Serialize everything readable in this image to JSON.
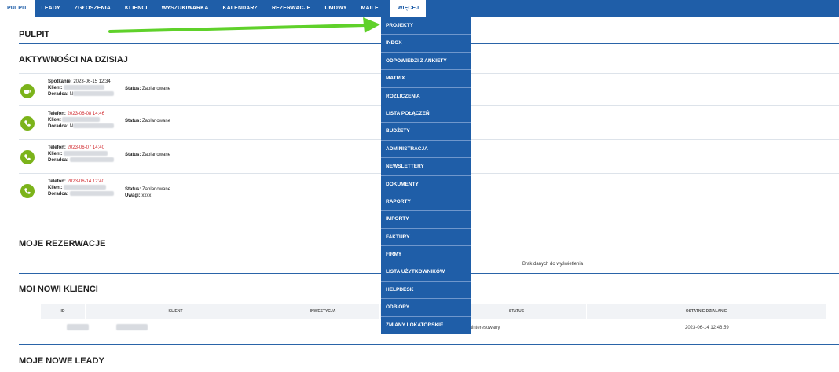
{
  "nav": {
    "items": [
      "PULPIT",
      "LEADY",
      "ZGŁOSZENIA",
      "KLIENCI",
      "WYSZUKIWARKA",
      "KALENDARZ",
      "REZERWACJE",
      "UMOWY",
      "MAILE"
    ],
    "more_label": "WIĘCEJ"
  },
  "page_title": "PULPIT",
  "activities": {
    "title": "AKTYWNOŚCI NA DZISIAJ",
    "items": [
      {
        "type_label": "Spotkanie:",
        "datetime": "2023-06-15 12:34",
        "client_label": "Klient:",
        "advisor_label": "Doradca:",
        "advisor_prefix": "N",
        "status_label": "Status:",
        "status_value": "Zaplanowane",
        "note_label": "",
        "note_value": "",
        "icon": "coffee-icon",
        "overdue": false
      },
      {
        "type_label": "Telefon:",
        "datetime": "2023-06-08 14:46",
        "client_label": "Klient",
        "advisor_label": "Doradca:",
        "advisor_prefix": "N",
        "status_label": "Status:",
        "status_value": "Zaplanowane",
        "note_label": "",
        "note_value": "",
        "icon": "phone-icon",
        "overdue": true
      },
      {
        "type_label": "Telefon:",
        "datetime": "2023-06-07 14:40",
        "client_label": "Klient:",
        "advisor_label": "Doradca:",
        "advisor_prefix": "",
        "status_label": "Status:",
        "status_value": "Zaplanowane",
        "note_label": "",
        "note_value": "",
        "icon": "phone-icon",
        "overdue": true
      },
      {
        "type_label": "Telefon:",
        "datetime": "2023-06-14 12:40",
        "client_label": "Klient:",
        "advisor_label": "Doradca:",
        "advisor_prefix": "",
        "status_label": "Status:",
        "status_value": "Zaplanowane",
        "note_label": "Uwagi:",
        "note_value": "xxxx",
        "icon": "phone-icon",
        "overdue": true
      }
    ]
  },
  "reservations": {
    "title": "MOJE REZERWACJE",
    "empty_text": "Brak danych do wyświetlenia"
  },
  "new_clients": {
    "title": "MOI NOWI KLIENCI",
    "columns": [
      "ID",
      "KLIENT",
      "INWESTYCJA",
      "",
      "STATUS",
      "OSTATNIE DZIAŁANIE"
    ],
    "row": {
      "status": "Zainteresowany",
      "last_action": "2023-06-14 12:46:59"
    }
  },
  "new_leads": {
    "title": "MOJE NOWE LEADY"
  },
  "dropdown": {
    "items": [
      "PROJEKTY",
      "INBOX",
      "ODPOWIEDZI Z ANKIETY",
      "MATRIX",
      "ROZLICZENIA",
      "LISTA POŁĄCZEŃ",
      "BUDŻETY",
      "ADMINISTRACJA",
      "NEWSLETTERY",
      "DOKUMENTY",
      "RAPORTY",
      "IMPORTY",
      "FAKTURY",
      "FIRMY",
      "LISTA UŻYTKOWNIKÓW",
      "HELPDESK",
      "ODBIORY",
      "ZMIANY LOKATORSKIE"
    ]
  },
  "colors": {
    "brand": "#1f5ea8",
    "icon_green": "#7bb31a",
    "overdue_red": "#d0262b",
    "arrow_green": "#5fd12a"
  }
}
